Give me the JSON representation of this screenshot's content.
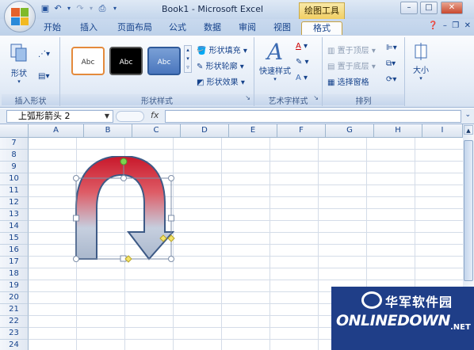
{
  "titlebar": {
    "title": "Book1 - Microsoft Excel",
    "context_tab": "绘图工具",
    "qat_icons": [
      "save-icon",
      "undo-icon",
      "redo-icon",
      "print-preview-icon"
    ],
    "minimize": "–",
    "maximize": "□",
    "close": "✕"
  },
  "tabs": [
    "开始",
    "插入",
    "页面布局",
    "公式",
    "数据",
    "审阅",
    "视图",
    "格式"
  ],
  "ribbon": {
    "insert_shapes": {
      "shapes_label": "形状",
      "label": "插入形状"
    },
    "shape_styles": {
      "gallery": [
        "Abc",
        "Abc",
        "Abc"
      ],
      "fill": "形状填充",
      "outline": "形状轮廓",
      "effects": "形状效果",
      "label": "形状样式"
    },
    "wordart": {
      "quick_styles": "快速样式",
      "label": "艺术字样式"
    },
    "arrange": {
      "bring_forward": "置于顶层",
      "send_backward": "置于底层",
      "selection_pane": "选择窗格",
      "label": "排列"
    },
    "size": {
      "label": "大小"
    }
  },
  "formula_bar": {
    "name_box": "上弧形箭头 2",
    "fx": "fx",
    "value": ""
  },
  "grid": {
    "columns": [
      "A",
      "B",
      "C",
      "D",
      "E",
      "F",
      "G",
      "H",
      "I"
    ],
    "rows": [
      "7",
      "8",
      "9",
      "10",
      "11",
      "12",
      "13",
      "14",
      "15",
      "16",
      "17",
      "18",
      "19",
      "20",
      "21",
      "22",
      "23",
      "24"
    ]
  },
  "colors": {
    "accent": "#15428b",
    "ribbon_bg": "#dbe6f4",
    "shape_red": "#c8172a",
    "shape_outline": "#3d5a86"
  },
  "watermark": {
    "title": "华军软件园",
    "brand": "ONLINEDOWN",
    "suffix": ".NET"
  }
}
